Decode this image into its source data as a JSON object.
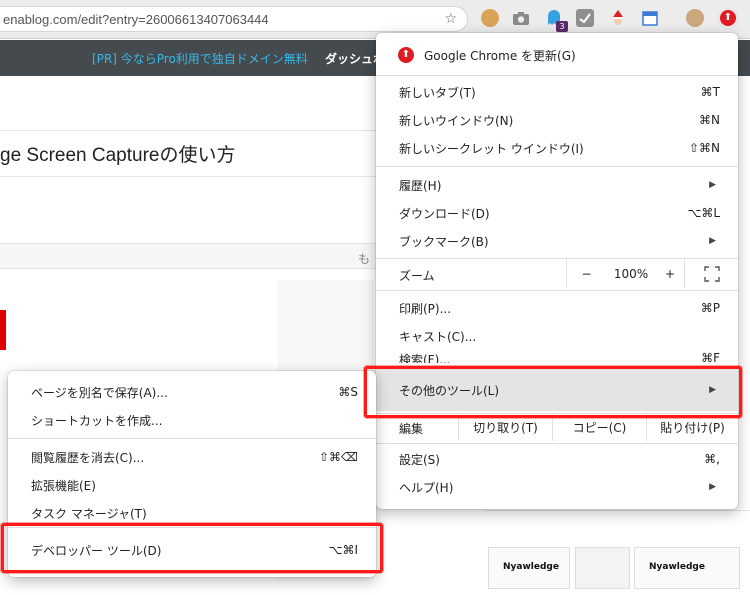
{
  "browser": {
    "url": "enablog.com/edit?entry=26006613407063444",
    "star_icon": "star-icon",
    "extensions": [
      "cookie-extension-icon",
      "camera-extension-icon",
      "ghost-extension-icon",
      "check-extension-icon",
      "santa-extension-icon",
      "calendar-extension-icon",
      "profile-avatar",
      "update-menu-icon"
    ],
    "extension_badge": "3"
  },
  "page": {
    "promo": "[PR] 今ならPro利用で独自ドメイン無料",
    "dashboard": "ダッシュボ",
    "title": "ge Screen Captureの使い方",
    "more": "も",
    "thumbnail_label": "Nyawledge"
  },
  "chrome_menu": {
    "update": {
      "label": "Google Chrome を更新(G)",
      "icon": "arrow-up-icon"
    },
    "items_group1": [
      {
        "label": "新しいタブ(T)",
        "shortcut": "⌘T"
      },
      {
        "label": "新しいウインドウ(N)",
        "shortcut": "⌘N"
      },
      {
        "label": "新しいシークレット ウインドウ(I)",
        "shortcut": "⇧⌘N"
      }
    ],
    "items_group2": [
      {
        "label": "履歴(H)",
        "submenu": true
      },
      {
        "label": "ダウンロード(D)",
        "shortcut": "⌥⌘L"
      },
      {
        "label": "ブックマーク(B)",
        "submenu": true
      }
    ],
    "zoom": {
      "label": "ズーム",
      "minus": "−",
      "value": "100%",
      "plus": "+",
      "fullscreen_icon": "fullscreen-icon"
    },
    "items_group3": [
      {
        "label": "印刷(P)...",
        "shortcut": "⌘P"
      },
      {
        "label": "キャスト(C)...",
        "shortcut": ""
      },
      {
        "label": "検索(F)...",
        "shortcut": "⌘F"
      },
      {
        "label": "その他のツール(L)",
        "submenu": true
      }
    ],
    "edit": {
      "label": "編集",
      "cut": "切り取り(T)",
      "copy": "コピー(C)",
      "paste": "貼り付け(P)"
    },
    "items_group4": [
      {
        "label": "設定(S)",
        "shortcut": "⌘,"
      },
      {
        "label": "ヘルプ(H)",
        "submenu": true
      }
    ]
  },
  "submenu": {
    "items_group1": [
      {
        "label": "ページを別名で保存(A)...",
        "shortcut": "⌘S"
      },
      {
        "label": "ショートカットを作成...",
        "shortcut": ""
      }
    ],
    "items_group2": [
      {
        "label": "閲覧履歴を消去(C)...",
        "shortcut": "⇧⌘⌫"
      },
      {
        "label": "拡張機能(E)",
        "shortcut": ""
      },
      {
        "label": "タスク マネージャ(T)",
        "shortcut": ""
      }
    ],
    "items_group3": [
      {
        "label": "デベロッパー ツール(D)",
        "shortcut": "⌥⌘I"
      }
    ]
  },
  "colors": {
    "highlight_red": "#ff1a1a",
    "update_red": "#e01b22",
    "topbar": "#444a4e",
    "promo_blue": "#39b8e6"
  }
}
